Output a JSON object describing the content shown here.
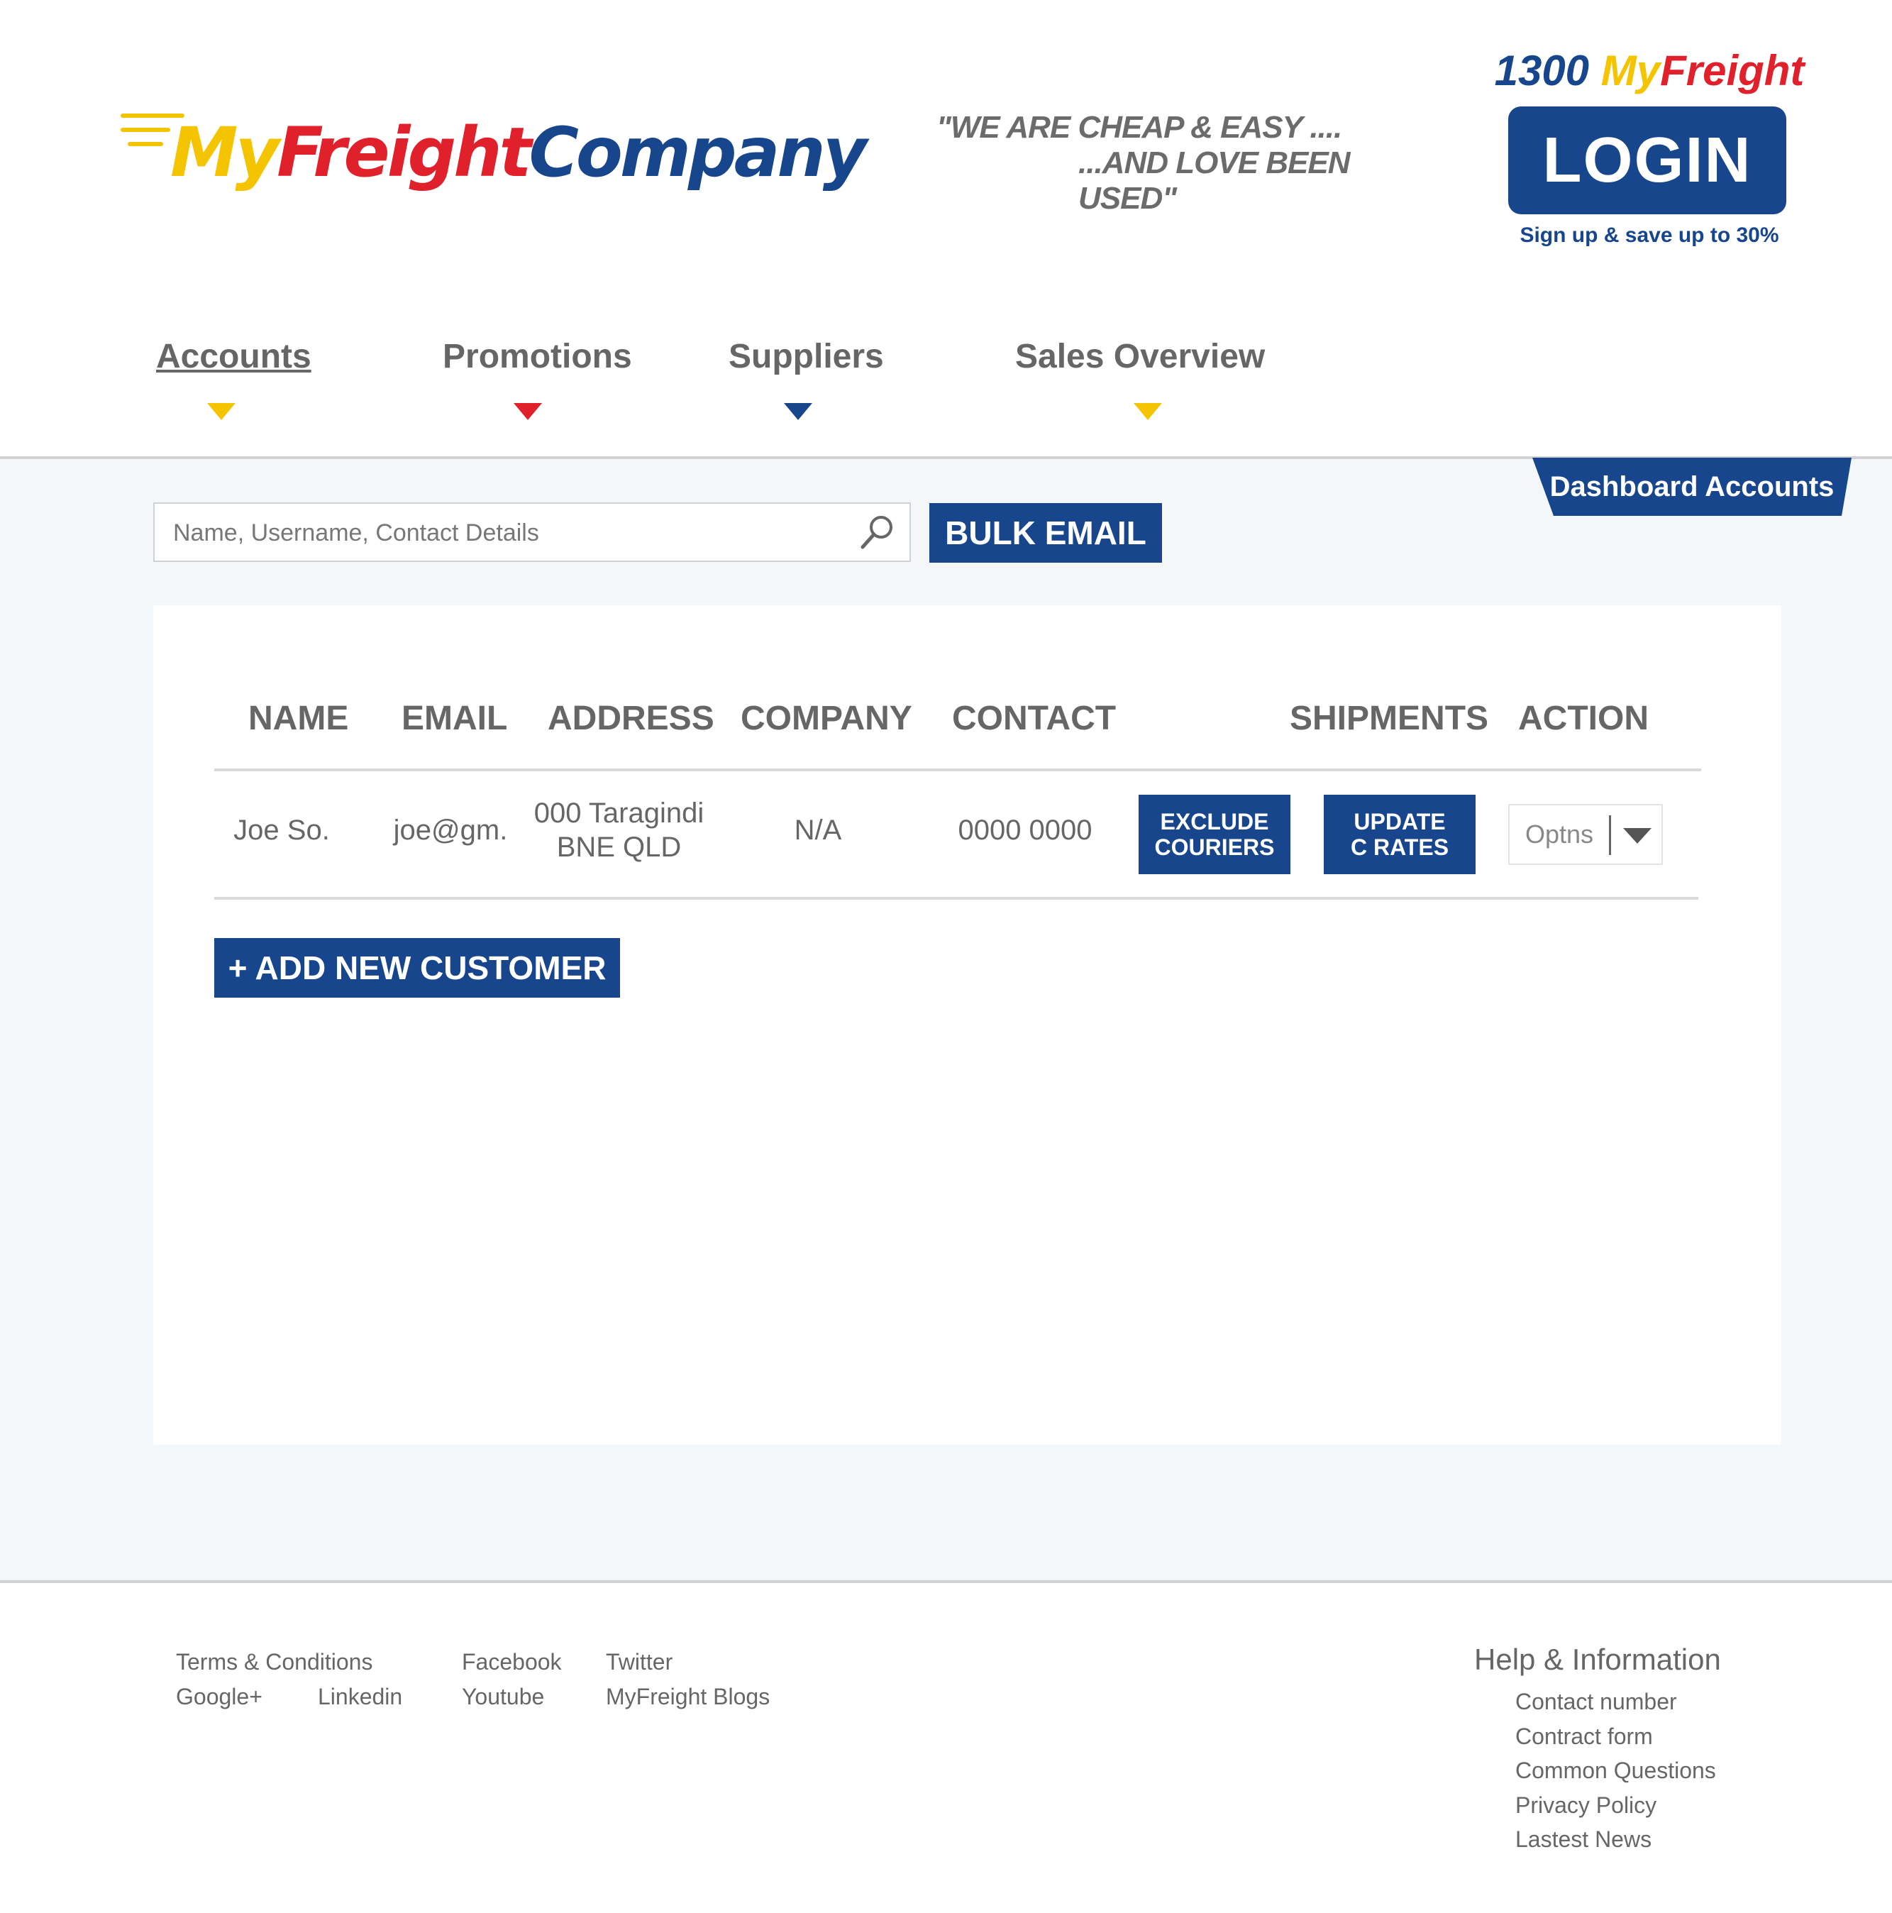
{
  "header": {
    "logo": {
      "my": "My",
      "freight": "Freight",
      "company": "Company"
    },
    "tagline": {
      "line1": "\"WE ARE CHEAP & EASY ....",
      "line2": "...AND LOVE BEEN USED\""
    },
    "phone": {
      "number": "1300 ",
      "my": "My",
      "freight": "Freight"
    },
    "login_label": "LOGIN",
    "signup_text": "Sign up & save up to 30%"
  },
  "nav": {
    "items": [
      {
        "label": "Accounts",
        "marker_color": "#f5c400"
      },
      {
        "label": "Promotions",
        "marker_color": "#e0202a"
      },
      {
        "label": "Suppliers",
        "marker_color": "#17468c"
      },
      {
        "label": "Sales Overview",
        "marker_color": "#f5c400"
      }
    ]
  },
  "dashboard_tab": "Dashboard Accounts",
  "search": {
    "placeholder": "Name, Username, Contact Details",
    "value": ""
  },
  "bulk_email_label": "BULK EMAIL",
  "table": {
    "headers": [
      "NAME",
      "EMAIL",
      "ADDRESS",
      "COMPANY",
      "CONTACT",
      "SHIPMENTS",
      "ACTION"
    ],
    "rows": [
      {
        "name": "Joe So.",
        "email": "joe@gm.",
        "address_line1": "000 Taragindi",
        "address_line2": "BNE QLD",
        "company": "N/A",
        "contact": "0000 0000",
        "exclude_line1": "EXCLUDE",
        "exclude_line2": "COURIERS",
        "update_line1": "UPDATE",
        "update_line2": "C RATES",
        "action_selected": "Optns"
      }
    ]
  },
  "add_customer_label": "+ ADD NEW CUSTOMER",
  "footer": {
    "links": {
      "terms": "Terms & Conditions",
      "facebook": "Facebook",
      "twitter": "Twitter",
      "google": "Google+",
      "linkedin": "Linkedin",
      "youtube": "Youtube",
      "blogs": "MyFreight Blogs"
    },
    "help": {
      "title": "Help & Information",
      "items": [
        "Contact number",
        "Contract form",
        "Common Questions",
        "Privacy Policy",
        "Lastest News"
      ]
    }
  },
  "colors": {
    "brand_blue": "#17468c",
    "brand_yellow": "#f5c400",
    "brand_red": "#e0202a",
    "main_bg": "#f4f7f9"
  }
}
